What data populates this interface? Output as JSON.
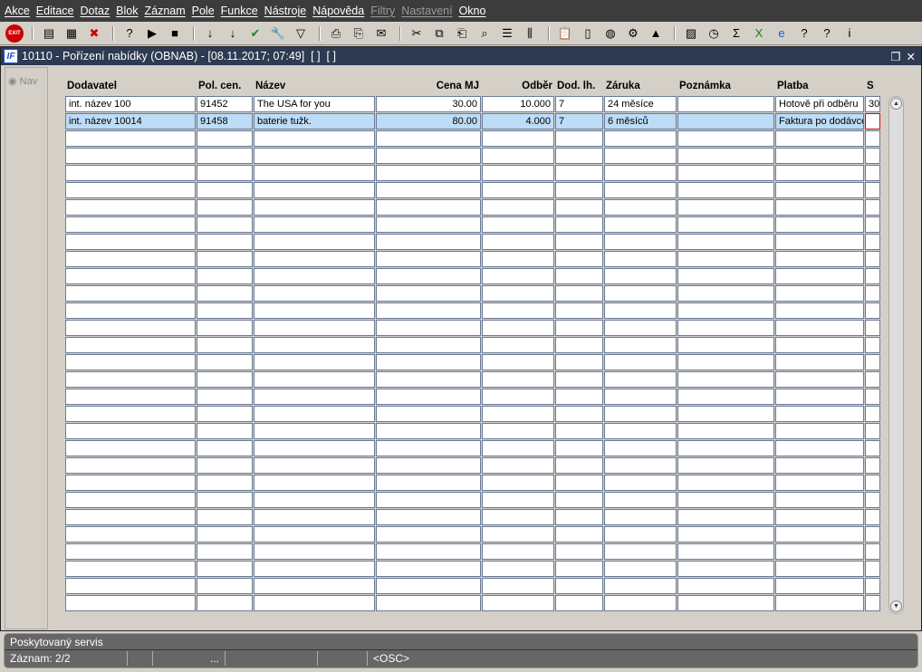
{
  "menu": [
    "Akce",
    "Editace",
    "Dotaz",
    "Blok",
    "Záznam",
    "Pole",
    "Funkce",
    "Nástroje",
    "Nápověda",
    "Filtry",
    "Nastavení",
    "Okno"
  ],
  "menu_disabled": [
    "Filtry",
    "Nastavení"
  ],
  "toolbar": {
    "exit_label": "EXIT",
    "icons": [
      [
        "exit-icon"
      ],
      [
        "insert-record-icon",
        "enter-query-icon",
        "delete-record-icon"
      ],
      [
        "query-help-icon",
        "execute-query-icon",
        "cancel-query-icon"
      ],
      [
        "sort-ascending-icon",
        "sort-descending-icon",
        "commit-check-icon",
        "wrench-icon",
        "filter-icon"
      ],
      [
        "print-icon",
        "print-setup-icon",
        "new-mail-icon"
      ],
      [
        "cut-icon",
        "copy-icon",
        "paste-icon",
        "zoom-icon",
        "list-icon",
        "columns-icon"
      ],
      [
        "clipboard-icon",
        "document-icon",
        "globe-icon",
        "gear-icon",
        "warning-icon"
      ],
      [
        "chart-icon",
        "clock-icon",
        "sum-icon",
        "excel-icon",
        "ie-icon",
        "help-icon",
        "help-question-icon",
        "info-icon"
      ]
    ]
  },
  "window": {
    "title": "10110 - Pořízení nabídky (OBNAB) - [08.11.2017; 07:49]  [ ]  [ ]",
    "logo": "IF"
  },
  "nav": {
    "label": "Nav"
  },
  "columns": [
    "Dodavatel",
    "Pol. cen.",
    "Název",
    "Cena MJ",
    "Odběr",
    "Dod. lh.",
    "Záruka",
    "Poznámka",
    "Platba",
    "S"
  ],
  "rows": [
    [
      "int. název 100",
      "91452",
      "The USA for you",
      "30.00",
      "10.000",
      "7",
      "24 měsíce",
      "",
      "Hotově při odběru",
      "30"
    ],
    [
      "int. název 10014",
      "91458",
      "baterie tužk.",
      "80.00",
      "4.000",
      "7",
      "6 měsíců",
      "",
      "Faktura po dodávce",
      ""
    ]
  ],
  "selected_row": 1,
  "status": {
    "message": "Poskytovaný servis",
    "record": "Záznam: 2/2",
    "field3": "...",
    "mode": "<OSC>"
  }
}
